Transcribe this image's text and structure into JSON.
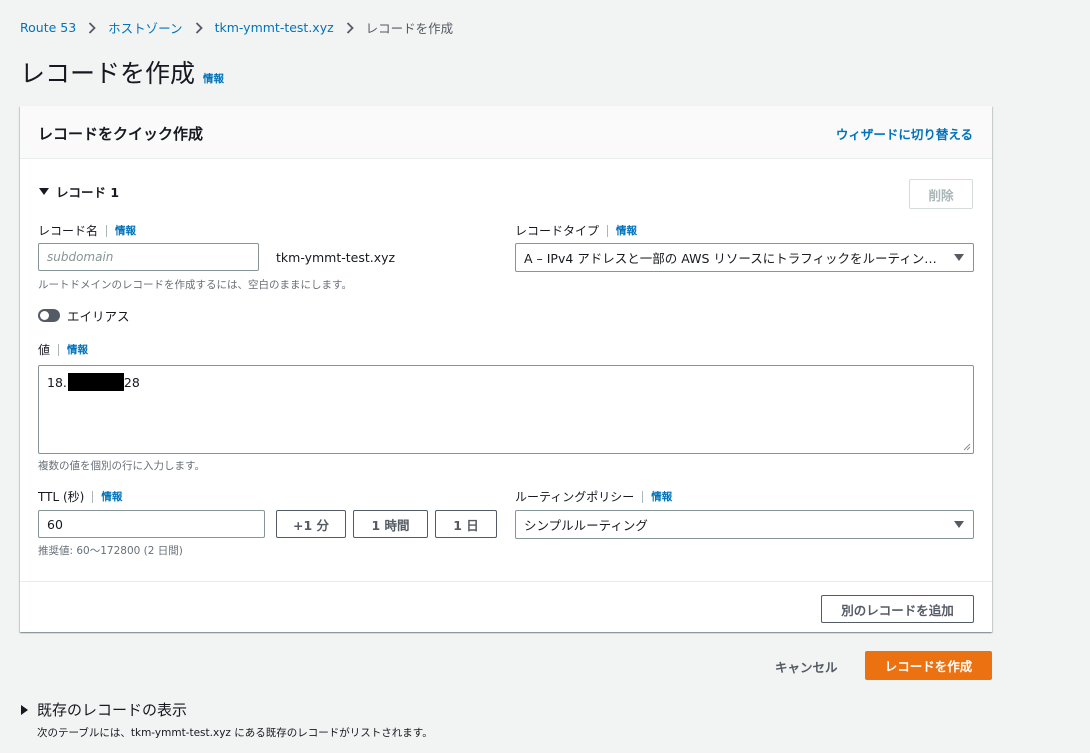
{
  "breadcrumb": {
    "items": [
      "Route 53",
      "ホストゾーン",
      "tkm-ymmt-test.xyz"
    ],
    "current": "レコードを作成"
  },
  "page": {
    "title": "レコードを作成",
    "info": "情報"
  },
  "panel": {
    "title": "レコードをクイック作成",
    "wizard_link": "ウィザードに切り替える",
    "record": {
      "heading": "レコード 1",
      "delete_label": "削除",
      "name_label": "レコード名",
      "name_info": "情報",
      "name_placeholder": "subdomain",
      "domain_suffix": "tkm-ymmt-test.xyz",
      "name_hint": "ルートドメインのレコードを作成するには、空白のままにします。",
      "type_label": "レコードタイプ",
      "type_info": "情報",
      "type_value": "A – IPv4 アドレスと一部の AWS リソースにトラフィックをルーティング…",
      "alias_label": "エイリアス",
      "alias_enabled": false,
      "value_label": "値",
      "value_info": "情報",
      "value_prefix": "18.",
      "value_suffix": "28",
      "value_hint": "複数の値を個別の行に入力します。",
      "ttl_label": "TTL (秒)",
      "ttl_info": "情報",
      "ttl_value": "60",
      "ttl_buttons": [
        "+1 分",
        "1 時間",
        "1 日"
      ],
      "ttl_hint": "推奨値: 60～172800 (2 日間)",
      "routing_label": "ルーティングポリシー",
      "routing_info": "情報",
      "routing_value": "シンプルルーティング"
    },
    "add_record_label": "別のレコードを追加"
  },
  "footer": {
    "cancel_label": "キャンセル",
    "create_label": "レコードを作成"
  },
  "existing": {
    "title": "既存のレコードの表示",
    "description": "次のテーブルには、tkm-ymmt-test.xyz にある既存のレコードがリストされます。"
  },
  "colors": {
    "primary": "#ec7211",
    "link": "#0073bb",
    "background": "#f2f3f3"
  }
}
